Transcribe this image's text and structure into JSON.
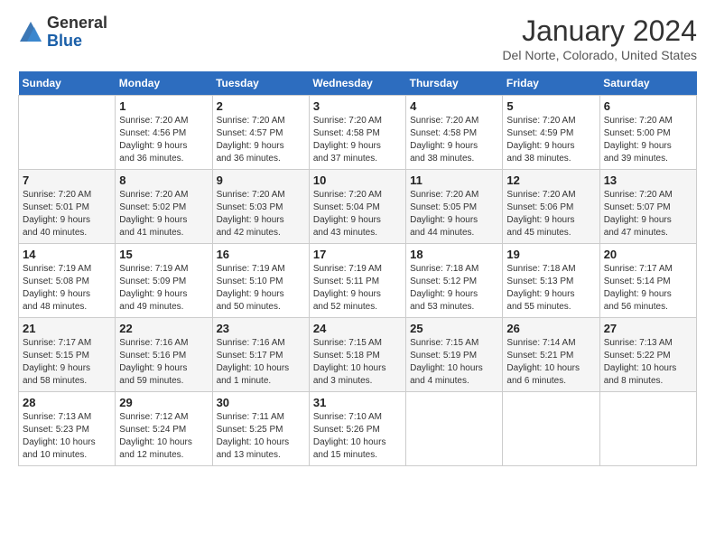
{
  "header": {
    "logo_general": "General",
    "logo_blue": "Blue",
    "month_year": "January 2024",
    "location": "Del Norte, Colorado, United States"
  },
  "weekdays": [
    "Sunday",
    "Monday",
    "Tuesday",
    "Wednesday",
    "Thursday",
    "Friday",
    "Saturday"
  ],
  "weeks": [
    [
      {
        "day": "",
        "info": ""
      },
      {
        "day": "1",
        "info": "Sunrise: 7:20 AM\nSunset: 4:56 PM\nDaylight: 9 hours\nand 36 minutes."
      },
      {
        "day": "2",
        "info": "Sunrise: 7:20 AM\nSunset: 4:57 PM\nDaylight: 9 hours\nand 36 minutes."
      },
      {
        "day": "3",
        "info": "Sunrise: 7:20 AM\nSunset: 4:58 PM\nDaylight: 9 hours\nand 37 minutes."
      },
      {
        "day": "4",
        "info": "Sunrise: 7:20 AM\nSunset: 4:58 PM\nDaylight: 9 hours\nand 38 minutes."
      },
      {
        "day": "5",
        "info": "Sunrise: 7:20 AM\nSunset: 4:59 PM\nDaylight: 9 hours\nand 38 minutes."
      },
      {
        "day": "6",
        "info": "Sunrise: 7:20 AM\nSunset: 5:00 PM\nDaylight: 9 hours\nand 39 minutes."
      }
    ],
    [
      {
        "day": "7",
        "info": "Sunrise: 7:20 AM\nSunset: 5:01 PM\nDaylight: 9 hours\nand 40 minutes."
      },
      {
        "day": "8",
        "info": "Sunrise: 7:20 AM\nSunset: 5:02 PM\nDaylight: 9 hours\nand 41 minutes."
      },
      {
        "day": "9",
        "info": "Sunrise: 7:20 AM\nSunset: 5:03 PM\nDaylight: 9 hours\nand 42 minutes."
      },
      {
        "day": "10",
        "info": "Sunrise: 7:20 AM\nSunset: 5:04 PM\nDaylight: 9 hours\nand 43 minutes."
      },
      {
        "day": "11",
        "info": "Sunrise: 7:20 AM\nSunset: 5:05 PM\nDaylight: 9 hours\nand 44 minutes."
      },
      {
        "day": "12",
        "info": "Sunrise: 7:20 AM\nSunset: 5:06 PM\nDaylight: 9 hours\nand 45 minutes."
      },
      {
        "day": "13",
        "info": "Sunrise: 7:20 AM\nSunset: 5:07 PM\nDaylight: 9 hours\nand 47 minutes."
      }
    ],
    [
      {
        "day": "14",
        "info": "Sunrise: 7:19 AM\nSunset: 5:08 PM\nDaylight: 9 hours\nand 48 minutes."
      },
      {
        "day": "15",
        "info": "Sunrise: 7:19 AM\nSunset: 5:09 PM\nDaylight: 9 hours\nand 49 minutes."
      },
      {
        "day": "16",
        "info": "Sunrise: 7:19 AM\nSunset: 5:10 PM\nDaylight: 9 hours\nand 50 minutes."
      },
      {
        "day": "17",
        "info": "Sunrise: 7:19 AM\nSunset: 5:11 PM\nDaylight: 9 hours\nand 52 minutes."
      },
      {
        "day": "18",
        "info": "Sunrise: 7:18 AM\nSunset: 5:12 PM\nDaylight: 9 hours\nand 53 minutes."
      },
      {
        "day": "19",
        "info": "Sunrise: 7:18 AM\nSunset: 5:13 PM\nDaylight: 9 hours\nand 55 minutes."
      },
      {
        "day": "20",
        "info": "Sunrise: 7:17 AM\nSunset: 5:14 PM\nDaylight: 9 hours\nand 56 minutes."
      }
    ],
    [
      {
        "day": "21",
        "info": "Sunrise: 7:17 AM\nSunset: 5:15 PM\nDaylight: 9 hours\nand 58 minutes."
      },
      {
        "day": "22",
        "info": "Sunrise: 7:16 AM\nSunset: 5:16 PM\nDaylight: 9 hours\nand 59 minutes."
      },
      {
        "day": "23",
        "info": "Sunrise: 7:16 AM\nSunset: 5:17 PM\nDaylight: 10 hours\nand 1 minute."
      },
      {
        "day": "24",
        "info": "Sunrise: 7:15 AM\nSunset: 5:18 PM\nDaylight: 10 hours\nand 3 minutes."
      },
      {
        "day": "25",
        "info": "Sunrise: 7:15 AM\nSunset: 5:19 PM\nDaylight: 10 hours\nand 4 minutes."
      },
      {
        "day": "26",
        "info": "Sunrise: 7:14 AM\nSunset: 5:21 PM\nDaylight: 10 hours\nand 6 minutes."
      },
      {
        "day": "27",
        "info": "Sunrise: 7:13 AM\nSunset: 5:22 PM\nDaylight: 10 hours\nand 8 minutes."
      }
    ],
    [
      {
        "day": "28",
        "info": "Sunrise: 7:13 AM\nSunset: 5:23 PM\nDaylight: 10 hours\nand 10 minutes."
      },
      {
        "day": "29",
        "info": "Sunrise: 7:12 AM\nSunset: 5:24 PM\nDaylight: 10 hours\nand 12 minutes."
      },
      {
        "day": "30",
        "info": "Sunrise: 7:11 AM\nSunset: 5:25 PM\nDaylight: 10 hours\nand 13 minutes."
      },
      {
        "day": "31",
        "info": "Sunrise: 7:10 AM\nSunset: 5:26 PM\nDaylight: 10 hours\nand 15 minutes."
      },
      {
        "day": "",
        "info": ""
      },
      {
        "day": "",
        "info": ""
      },
      {
        "day": "",
        "info": ""
      }
    ]
  ]
}
